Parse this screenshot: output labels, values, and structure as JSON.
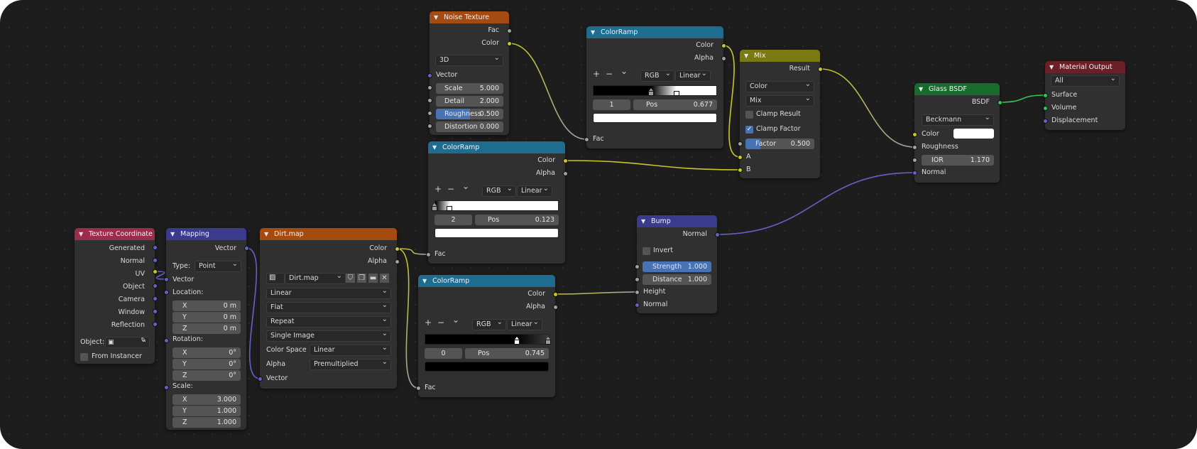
{
  "colors": {
    "bg": "#1d1d1d",
    "node": "#303030",
    "hdr_texture": "#a54a10",
    "hdr_converter": "#1e6c8f",
    "hdr_input": "#9c2c4c",
    "hdr_vector": "#3b3b8e",
    "hdr_color": "#7a7a14",
    "hdr_shader": "#196b2d",
    "hdr_output": "#6b2027",
    "accent": "#4772b3",
    "socket_color": "#c7c729",
    "socket_float": "#a1a1a1",
    "socket_vector": "#6363c7",
    "socket_shader": "#37c159"
  },
  "texcoord": {
    "title": "Texture Coordinate",
    "outputs": [
      "Generated",
      "Normal",
      "UV",
      "Object",
      "Camera",
      "Window",
      "Reflection"
    ],
    "object_label": "Object:",
    "from_instancer": "From Instancer",
    "icons": [
      "collapse-chevron",
      "object-icon",
      "eyedropper-icon"
    ]
  },
  "mapping": {
    "title": "Mapping",
    "out": "Vector",
    "type_label": "Type:",
    "type_value": "Point",
    "in_vector": "Vector",
    "location_label": "Location:",
    "rotation_label": "Rotation:",
    "scale_label": "Scale:",
    "loc": [
      [
        "X",
        "0 m"
      ],
      [
        "Y",
        "0 m"
      ],
      [
        "Z",
        "0 m"
      ]
    ],
    "rot": [
      [
        "X",
        "0°"
      ],
      [
        "Y",
        "0°"
      ],
      [
        "Z",
        "0°"
      ]
    ],
    "scl": [
      [
        "X",
        "3.000"
      ],
      [
        "Y",
        "1.000"
      ],
      [
        "Z",
        "1.000"
      ]
    ],
    "in_vector_bottom": "Vector"
  },
  "dirt": {
    "title": "Dirt.map",
    "out_color": "Color",
    "out_alpha": "Alpha",
    "image_name": "Dirt.map",
    "interp": "Linear",
    "proj": "Flat",
    "ext": "Repeat",
    "source": "Single Image",
    "cs_label": "Color Space",
    "cs_value": "Linear",
    "alpha_label": "Alpha",
    "alpha_value": "Premultiplied",
    "in_vector": "Vector",
    "icons": [
      "image-icon",
      "shield-icon",
      "duplicate-icon",
      "folder-icon",
      "close-icon"
    ]
  },
  "noise": {
    "title": "Noise Texture",
    "out_fac": "Fac",
    "out_color": "Color",
    "dim": "3D",
    "in_vector": "Vector",
    "fields": [
      [
        "Scale",
        "5.000",
        0
      ],
      [
        "Detail",
        "2.000",
        0
      ],
      [
        "Roughness",
        "0.500",
        0.5
      ],
      [
        "Distortion",
        "0.000",
        0
      ]
    ]
  },
  "cr1": {
    "title": "ColorRamp",
    "out_color": "Color",
    "out_alpha": "Alpha",
    "mode": "RGB",
    "interp": "Linear",
    "index": "1",
    "pos_label": "Pos",
    "pos": "0.677",
    "in_fac": "Fac",
    "stops": [
      0.47,
      0.677
    ],
    "active": 1,
    "swatch": "#ffffff",
    "toolbar": [
      "+",
      "−",
      "⌄"
    ]
  },
  "cr2": {
    "title": "ColorRamp",
    "out_color": "Color",
    "out_alpha": "Alpha",
    "mode": "RGB",
    "interp": "Linear",
    "index": "2",
    "pos_label": "Pos",
    "pos": "0.123",
    "in_fac": "Fac",
    "stops": [
      0.0,
      0.123
    ],
    "active": 1,
    "swatch": "#ffffff",
    "toolbar": [
      "+",
      "−",
      "⌄"
    ]
  },
  "cr3": {
    "title": "ColorRamp",
    "out_color": "Color",
    "out_alpha": "Alpha",
    "mode": "RGB",
    "interp": "Linear",
    "index": "0",
    "pos_label": "Pos",
    "pos": "0.745",
    "in_fac": "Fac",
    "stops": [
      0.745,
      1.0
    ],
    "active": 0,
    "swatch": "#000000",
    "toolbar": [
      "+",
      "−",
      "⌄"
    ]
  },
  "mix": {
    "title": "Mix",
    "out": "Result",
    "data_type": "Color",
    "blend": "Mix",
    "clamp_result": "Clamp Result",
    "clamp_factor": "Clamp Factor",
    "factor_label": "Factor",
    "factor_value": "0.500",
    "factor_fill": 0.5,
    "in_a": "A",
    "in_b": "B"
  },
  "bump": {
    "title": "Bump",
    "out": "Normal",
    "invert": "Invert",
    "strength_label": "Strength",
    "strength": "1.000",
    "strength_fill": 1.0,
    "distance_label": "Distance",
    "distance": "1.000",
    "in_height": "Height",
    "in_normal": "Normal"
  },
  "glass": {
    "title": "Glass BSDF",
    "out": "BSDF",
    "dist": "Beckmann",
    "in_color": "Color",
    "color_swatch": "#ffffff",
    "in_rough": "Roughness",
    "ior_label": "IOR",
    "ior": "1.170",
    "in_normal": "Normal"
  },
  "matout": {
    "title": "Material Output",
    "target": "All",
    "in_surface": "Surface",
    "in_volume": "Volume",
    "in_disp": "Displacement"
  }
}
